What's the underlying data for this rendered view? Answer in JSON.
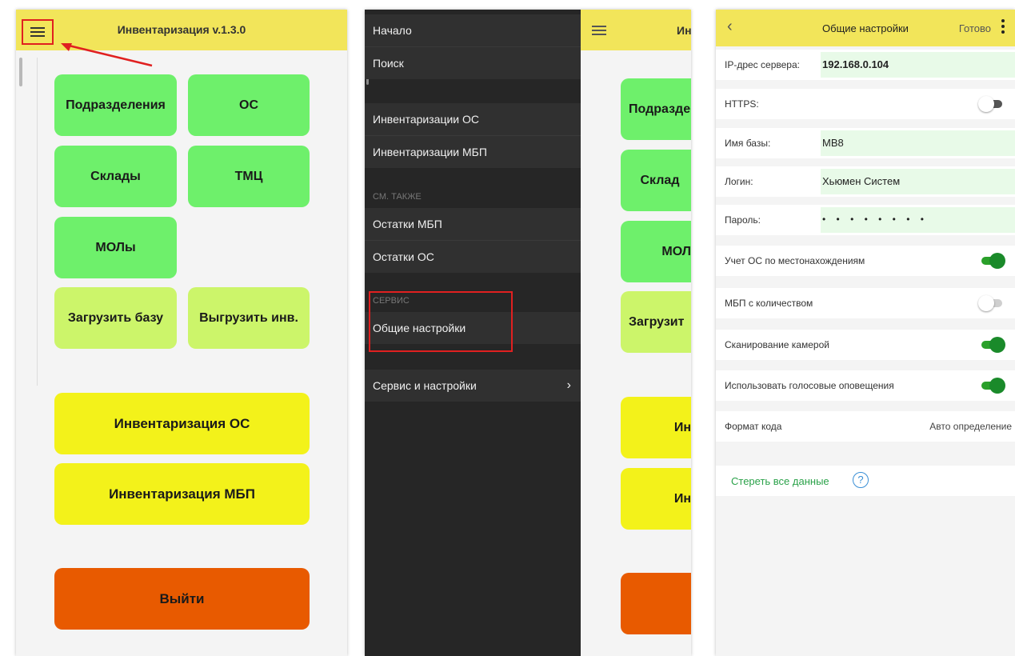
{
  "main": {
    "title": "Инвентаризация v.1.3.0",
    "tiles": [
      "Подразделения",
      "ОС",
      "Склады",
      "ТМЦ",
      "МОЛы",
      "Загрузить базу",
      "Выгрузить инв."
    ],
    "inv_os": "Инвентаризация ОС",
    "inv_mbp": "Инвентаризация МБП",
    "exit": "Выйти"
  },
  "drawer": {
    "items": [
      "Начало",
      "Поиск",
      "Инвентаризации ОС",
      "Инвентаризации МБП"
    ],
    "section_see_also": "СМ. ТАКЖЕ",
    "see_also_items": [
      "Остатки МБП",
      "Остатки ОС"
    ],
    "section_service": "СЕРВИС",
    "general_settings": "Общие настройки",
    "service_settings": "Сервис и настройки",
    "behind_title": "Ин",
    "behind_tiles": [
      "Подразде",
      "Склад",
      "МОЛ",
      "Загрузит",
      "Ин",
      "Ин"
    ]
  },
  "settings": {
    "title": "Общие настройки",
    "done": "Готово",
    "ip_label": "IP-дрес сервера:",
    "ip_value": "192.168.0.104",
    "https_label": "HTTPS:",
    "db_label": "Имя базы:",
    "db_value": "MB8",
    "login_label": "Логин:",
    "login_value": "Хьюмен Систем",
    "password_label": "Пароль:",
    "password_value": "• • • • • • • •",
    "os_location_label": "Учет ОС по местонахождениям",
    "mbp_qty_label": "МБП с количеством",
    "camera_label": "Сканирование камерой",
    "voice_label": "Использовать голосовые оповещения",
    "code_format_label": "Формат кода",
    "code_format_value": "Авто определение",
    "clear_data": "Стереть все данные",
    "help_symbol": "?",
    "toggles": {
      "https": false,
      "os_location": true,
      "mbp_qty": false,
      "camera": true,
      "voice": true
    }
  }
}
